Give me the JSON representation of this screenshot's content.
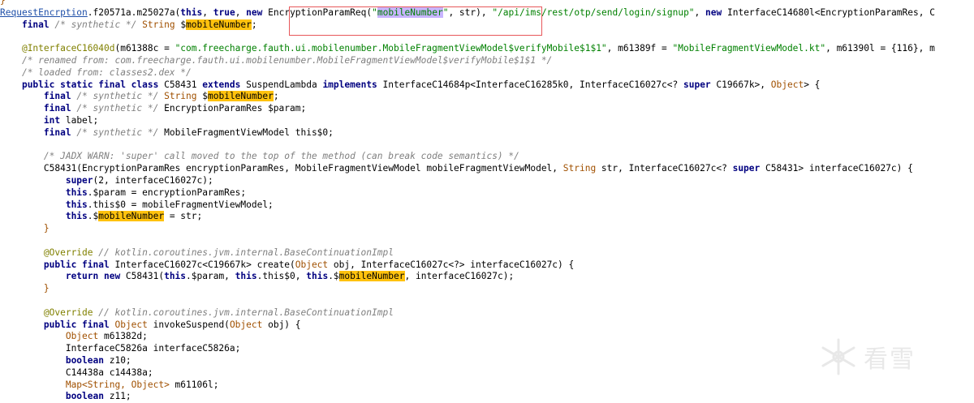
{
  "watermark": {
    "text": "看雪"
  },
  "code": {
    "l0": {
      "brace": "}"
    },
    "l1": {
      "link": "RequestEncrption",
      "a": ".f20571a.m25027a(",
      "k_this": "this",
      "c1": ", ",
      "k_true": "true",
      "c2": ", ",
      "k_new": "new",
      "s1": " EncryptionParamReq(",
      "q1": "\"",
      "hl": "mobileNumber",
      "q2": "\"",
      "s2": ", str), ",
      "url": "\"/api/ims/rest/otp/send/login/signup\"",
      "s3": ", ",
      "k_new2": "new",
      "s4": " InterfaceC14680l<EncryptionParamRes, C"
    },
    "l2": {
      "k_final": "final",
      "cm": " /* synthetic */ ",
      "ty": "String",
      "d": " $",
      "hl": "mobileNumber",
      "end": ";"
    },
    "l4": {
      "an": "@InterfaceC16040d",
      "a": "(m61388c = ",
      "s1": "\"com.freecharge.fauth.ui.mobilenumber.MobileFragmentViewModel$verifyMobile$1$1\"",
      "b": ", m61389f = ",
      "s2": "\"MobileFragmentViewModel.kt\"",
      "c": ", m61390l = {116}, m"
    },
    "l5": {
      "cm": "/* renamed from: com.freecharge.fauth.ui.mobilenumber.MobileFragmentViewModel$verifyMobile$1$1 */"
    },
    "l6": {
      "cm": "/* loaded from: classes2.dex */"
    },
    "l7": {
      "k1": "public static final class",
      "a": " C58431 ",
      "k2": "extends",
      "b": " SuspendLambda ",
      "k3": "implements",
      "c": " InterfaceC14684p<InterfaceC16285k0, InterfaceC16027c<? ",
      "k4": "super",
      "d": " C19667k>, ",
      "ty": "Object",
      "e": "> {"
    },
    "l8": {
      "k": "final",
      "cm": " /* synthetic */ ",
      "ty": "String",
      "d": " $",
      "hl": "mobileNumber",
      "end": ";"
    },
    "l9": {
      "k": "final",
      "cm": " /* synthetic */ ",
      "rest": "EncryptionParamRes $param;"
    },
    "l10": {
      "k": "int",
      "rest": " label;"
    },
    "l11": {
      "k": "final",
      "cm": " /* synthetic */ ",
      "rest": "MobileFragmentViewModel this$0;"
    },
    "l13": {
      "cm": "/* JADX WARN: 'super' call moved to the top of the method (can break code semantics) */"
    },
    "l14": {
      "a": "C58431(EncryptionParamRes encryptionParamRes, MobileFragmentViewModel mobileFragmentViewModel, ",
      "ty": "String",
      "b": " str, InterfaceC16027c<? ",
      "k": "super",
      "c": " C58431> interfaceC16027c) {"
    },
    "l15": {
      "k": "super",
      "rest": "(2, interfaceC16027c);"
    },
    "l16": {
      "k": "this",
      "rest": ".$param = encryptionParamRes;"
    },
    "l17": {
      "k": "this",
      "rest": ".this$0 = mobileFragmentViewModel;"
    },
    "l18": {
      "k": "this",
      "a": ".$",
      "hl": "mobileNumber",
      "rest": " = str;"
    },
    "l19": {
      "brace": "}"
    },
    "l21": {
      "an": "@Override",
      "cm": " // kotlin.coroutines.jvm.internal.BaseContinuationImpl"
    },
    "l22": {
      "k": "public final",
      "a": " InterfaceC16027c<C19667k> create(",
      "ty": "Object",
      "b": " obj, InterfaceC16027c<?> interfaceC16027c) {"
    },
    "l23": {
      "k1": "return new",
      "a": " C58431(",
      "k2": "this",
      "b": ".$param, ",
      "k3": "this",
      "c": ".this$0, ",
      "k4": "this",
      "d": ".$",
      "hl": "mobileNumber",
      "e": ", interfaceC16027c);"
    },
    "l24": {
      "brace": "}"
    },
    "l26": {
      "an": "@Override",
      "cm": " // kotlin.coroutines.jvm.internal.BaseContinuationImpl"
    },
    "l27": {
      "k": "public final",
      "ty": "Object",
      "a": " invokeSuspend(",
      "ty2": "Object",
      "b": " obj) {"
    },
    "l28": {
      "ty": "Object",
      "rest": " m61382d;"
    },
    "l29": {
      "rest": "InterfaceC5826a interfaceC5826a;"
    },
    "l30": {
      "k": "boolean",
      "rest": " z10;"
    },
    "l31": {
      "rest": "C14438a c14438a;"
    },
    "l32": {
      "ty": "Map<String, Object>",
      "rest": " m61106l;"
    },
    "l33": {
      "k": "boolean",
      "rest": " z11;"
    }
  }
}
